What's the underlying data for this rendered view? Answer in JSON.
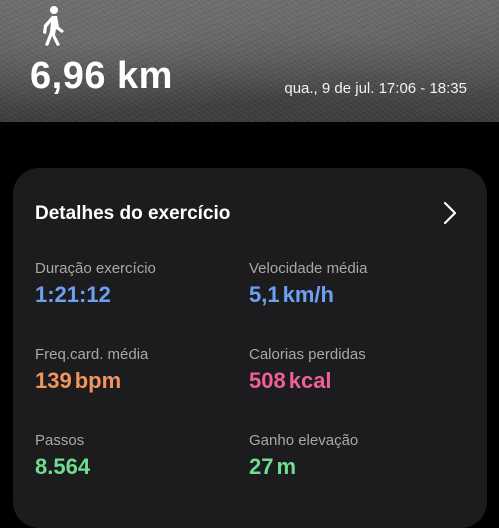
{
  "header": {
    "activity_icon": "walking-person-icon",
    "distance": "6,96 km",
    "datetime": "qua., 9 de jul. 17:06 - 18:35"
  },
  "card": {
    "title": "Detalhes do exercício",
    "chevron_icon": "chevron-right-icon",
    "metrics": [
      {
        "label": "Duração exercício",
        "value": "1:21:12",
        "unit": "",
        "color": "#6ca1f2"
      },
      {
        "label": "Velocidade média",
        "value": "5,1",
        "unit": "km/h",
        "color": "#6ca1f2"
      },
      {
        "label": "Freq.card. média",
        "value": "139",
        "unit": "bpm",
        "color": "#f0955e"
      },
      {
        "label": "Calorias perdidas",
        "value": "508",
        "unit": "kcal",
        "color": "#ef5f9b"
      },
      {
        "label": "Passos",
        "value": "8.564",
        "unit": "",
        "color": "#6fdc91"
      },
      {
        "label": "Ganho elevação",
        "value": "27",
        "unit": "m",
        "color": "#6fdc91"
      }
    ]
  }
}
